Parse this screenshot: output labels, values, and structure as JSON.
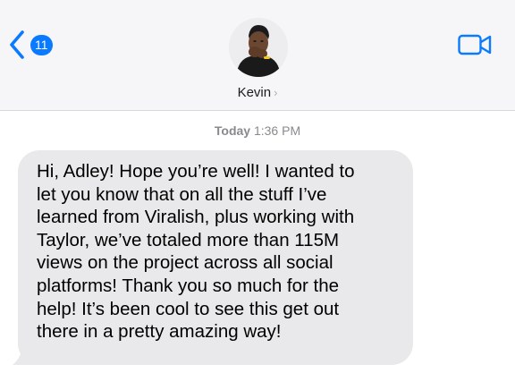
{
  "header": {
    "back_badge_count": "11",
    "contact_name": "Kevin",
    "contact_chevron": "›",
    "icons": {
      "back": "chevron-left-icon",
      "video": "video-camera-icon",
      "avatar": "contact-avatar"
    }
  },
  "thread": {
    "timestamp_day": "Today",
    "timestamp_time": "1:36 PM",
    "message": {
      "lines": [
        "Hi, Adley! Hope you’re well! I wanted to",
        "let you know that on all the stuff I’ve",
        "learned from Viralish, plus working with",
        "Taylor, we’ve totaled more than 115M",
        "views on the project across all social",
        "platforms! Thank you so much for the",
        "help! It’s been cool to see this get out",
        "there in a pretty amazing way!"
      ]
    }
  },
  "colors": {
    "accent": "#0a7aff",
    "header_bg": "#f6f6f8",
    "bubble_bg": "#e9e9eb",
    "timestamp": "#8a8a8e"
  }
}
